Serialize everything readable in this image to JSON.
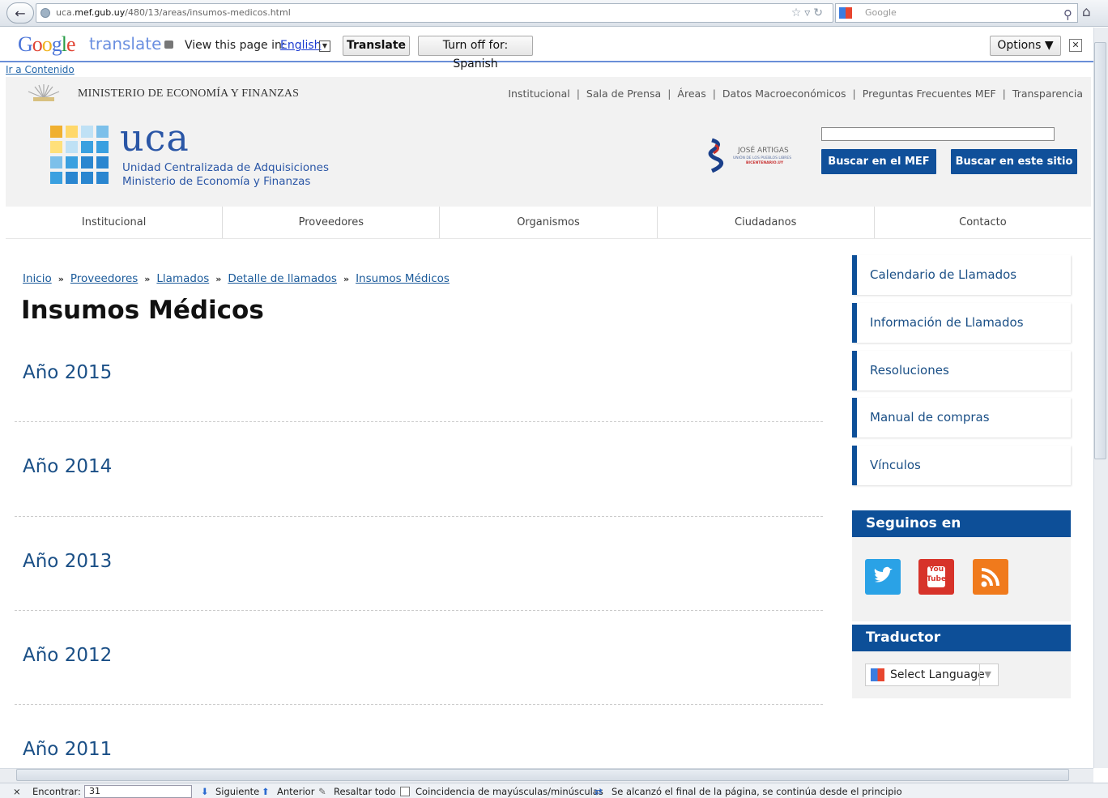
{
  "browser": {
    "url_domain_prefix": "uca.",
    "url_domain": "mef.gub.uy",
    "url_path": "/480/13/areas/insumos-medicos.html",
    "search_engine": "Google"
  },
  "translate_bar": {
    "brand": "Google",
    "product": "translate",
    "view_label": "View this page in:",
    "language": "English",
    "translate_button": "Translate",
    "turn_off_button": "Turn off for: Spanish",
    "options_button": "Options ▼",
    "close_symbol": "✕"
  },
  "skip_link": "Ir a Contenido",
  "header": {
    "ministry": "MINISTERIO DE ECONOMÍA Y FINANZAS",
    "top_nav": [
      "Institucional",
      "Sala de Prensa",
      "Áreas",
      "Datos Macroeconómicos",
      "Preguntas Frecuentes MEF",
      "Transparencia"
    ],
    "logo_text": "uca",
    "logo_sub1": "Unidad Centralizada de Adquisiciones",
    "logo_sub2": "Ministerio de Economía y Finanzas",
    "artigas_line1": "JOSÉ ARTIGAS",
    "artigas_line2": "UNIÓN DE LOS PUEBLOS LIBRES",
    "artigas_line3": "BICENTENARIO.UY",
    "search_mef": "Buscar en el MEF",
    "search_site": "Buscar en este sitio"
  },
  "main_nav": [
    "Institucional",
    "Proveedores",
    "Organismos",
    "Ciudadanos",
    "Contacto"
  ],
  "breadcrumb": [
    "Inicio",
    "Proveedores",
    "Llamados",
    "Detalle de llamados",
    "Insumos Médicos"
  ],
  "breadcrumb_sep": "»",
  "page_title": "Insumos Médicos",
  "years": [
    "Año 2015",
    "Año 2014",
    "Año 2013",
    "Año 2012",
    "Año 2011"
  ],
  "sidebar": {
    "links": [
      "Calendario de Llamados",
      "Información de Llamados",
      "Resoluciones",
      "Manual de compras",
      "Vínculos"
    ],
    "follow_title": "Seguinos en",
    "social": [
      "twitter-icon",
      "youtube-icon",
      "rss-icon"
    ],
    "youtube_text_1": "You",
    "youtube_text_2": "Tube",
    "translator_title": "Traductor",
    "select_language": "Select Language",
    "select_arrow": "▼"
  },
  "find_bar": {
    "close": "×",
    "find_label": "Encontrar:",
    "find_value": "31",
    "next": "Siguiente",
    "previous": "Anterior",
    "highlight_all": "Resaltar todo",
    "match_case": "Coincidencia de mayúsculas/minúsculas",
    "status": "Se alcanzó el final de la página, se continúa desde el principio"
  },
  "colors": {
    "accent": "#0d4f98",
    "link": "#1a4f86"
  }
}
